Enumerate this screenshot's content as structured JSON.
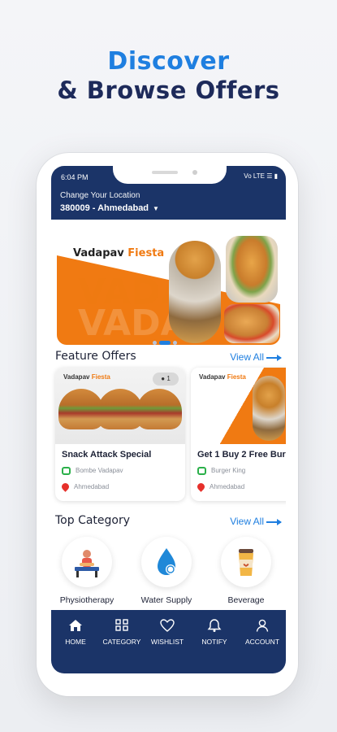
{
  "headline": {
    "line1": "Discover",
    "line2": "&  Browse Offers"
  },
  "status_bar": {
    "time": "6:04 PM",
    "right": "Vo LTE"
  },
  "location": {
    "label": "Change Your Location",
    "value": "380009 - Ahmedabad"
  },
  "banner": {
    "brand": "Vadapav",
    "brand_accent": "Fiesta",
    "watermark": "VADA",
    "carousel": {
      "count": 3,
      "active": 1
    }
  },
  "feature_offers": {
    "title": "Feature Offers",
    "view_all": "View All",
    "cards": [
      {
        "brand": "Vadapav",
        "brand_accent": "Fiesta",
        "badge": "1",
        "title": "Snack Attack Special",
        "store": "Bombe Vadapav",
        "city": "Ahmedabad"
      },
      {
        "brand": "Vadapav",
        "brand_accent": "Fiesta",
        "title": "Get 1 Buy 2 Free Bur",
        "store": "Burger King",
        "city": "Ahmedabad"
      }
    ]
  },
  "top_category": {
    "title": "Top Category",
    "view_all": "View All",
    "items": [
      {
        "label": "Physiotherapy",
        "icon": "physiotherapy-icon"
      },
      {
        "label": "Water Supply",
        "icon": "water-drop-icon"
      },
      {
        "label": "Beverage",
        "icon": "coffee-cup-icon"
      }
    ]
  },
  "bottom_nav": [
    {
      "label": "HOME",
      "icon": "home-icon",
      "active": true
    },
    {
      "label": "CATEGORY",
      "icon": "grid-icon",
      "active": false
    },
    {
      "label": "WISHLIST",
      "icon": "heart-icon",
      "active": false
    },
    {
      "label": "NOTIFY",
      "icon": "bell-icon",
      "active": false
    },
    {
      "label": "ACCOUNT",
      "icon": "user-icon",
      "active": false
    }
  ],
  "colors": {
    "primary": "#1b3468",
    "accent": "#1f7fe0",
    "orange": "#f07a12"
  }
}
